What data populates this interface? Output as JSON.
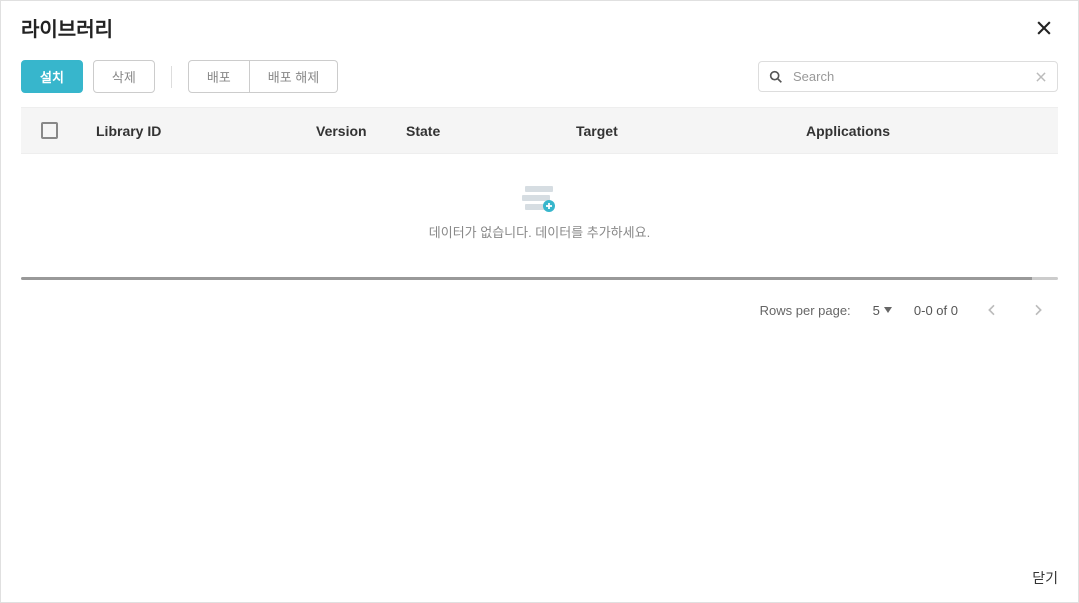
{
  "modal": {
    "title": "라이브러리"
  },
  "toolbar": {
    "install": "설치",
    "delete": "삭제",
    "deploy": "배포",
    "undeploy": "배포 해제"
  },
  "search": {
    "placeholder": "Search"
  },
  "table": {
    "headers": {
      "libraryId": "Library ID",
      "version": "Version",
      "state": "State",
      "target": "Target",
      "applications": "Applications"
    },
    "emptyMessage": "데이터가 없습니다. 데이터를 추가하세요."
  },
  "pagination": {
    "rowsPerPageLabel": "Rows per page:",
    "rowsPerPage": "5",
    "range": "0-0 of 0"
  },
  "footer": {
    "close": "닫기"
  }
}
